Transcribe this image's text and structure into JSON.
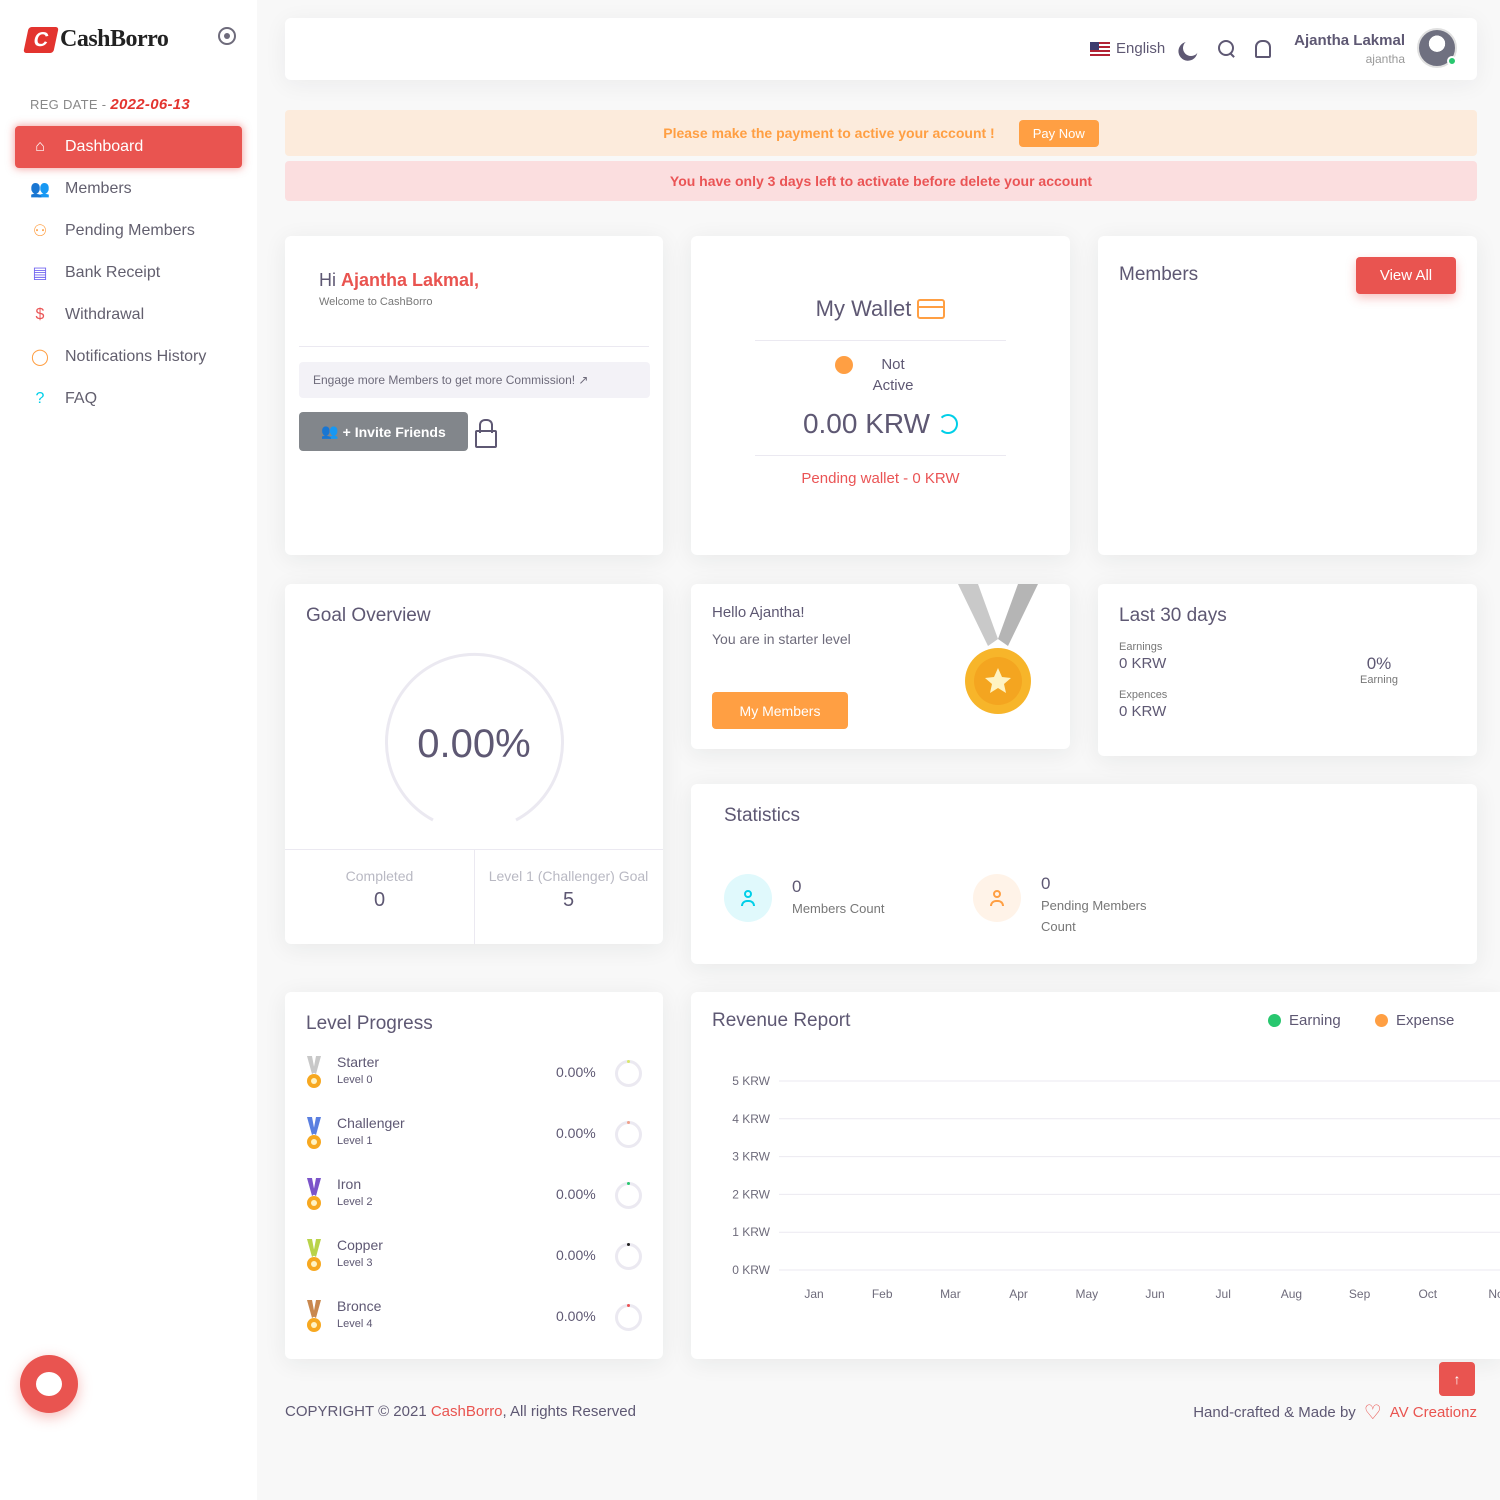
{
  "brand": {
    "name": "CashBorro",
    "accent": "#e95450"
  },
  "sidebar": {
    "reg_label": "REG DATE - ",
    "reg_date": "2022-06-13",
    "items": [
      {
        "label": "Dashboard",
        "icon": "home-icon",
        "active": true
      },
      {
        "label": "Members",
        "icon": "users-icon"
      },
      {
        "label": "Pending Members",
        "icon": "user-x-icon"
      },
      {
        "label": "Bank Receipt",
        "icon": "file-text-icon"
      },
      {
        "label": "Withdrawal",
        "icon": "dollar-icon"
      },
      {
        "label": "Notifications History",
        "icon": "message-circle-icon"
      },
      {
        "label": "FAQ",
        "icon": "help-circle-icon"
      }
    ]
  },
  "topbar": {
    "language": "English",
    "user_name": "Ajantha Lakmal",
    "username": "ajantha"
  },
  "alerts": {
    "payment_msg": "Please make the payment to active your account !",
    "pay_now": "Pay Now",
    "delete_msg": "You have only 3 days left to activate before delete your account"
  },
  "welcome": {
    "hi": "Hi",
    "name": "Ajantha Lakmal,",
    "sub": "Welcome to CashBorro",
    "engage": "Engage more Members to get more Commission! ↗",
    "invite": "+ Invite Friends"
  },
  "wallet": {
    "title": "My Wallet",
    "status": "Not Active",
    "amount": "0.00 KRW",
    "pending": "Pending wallet - 0 KRW"
  },
  "members_card": {
    "title": "Members",
    "view_all": "View All"
  },
  "goal": {
    "title": "Goal Overview",
    "percent": "0.00%",
    "completed_label": "Completed",
    "completed_value": "0",
    "goal_label": "Level 1 (Challenger) Goal",
    "goal_value": "5"
  },
  "hello": {
    "line1": "Hello Ajantha!",
    "line2": "You are in starter level",
    "button": "My Members"
  },
  "last30": {
    "title": "Last 30 days",
    "earnings_label": "Earnings",
    "earnings_value": "0 KRW",
    "expences_label": "Expences",
    "expences_value": "0 KRW",
    "pct": "0%",
    "pct_label": "Earning"
  },
  "statistics": {
    "title": "Statistics",
    "members_count": "0",
    "members_label": "Members Count",
    "pending_count": "0",
    "pending_label": "Pending Members Count"
  },
  "levels": {
    "title": "Level Progress",
    "items": [
      {
        "name": "Starter",
        "sub": "Level 0",
        "pct": "0.00%",
        "ribbon": "#c8c8c8",
        "dot": "#d9e86a"
      },
      {
        "name": "Challenger",
        "sub": "Level 1",
        "pct": "0.00%",
        "ribbon": "#5a7fe0",
        "dot": "#f0a08a"
      },
      {
        "name": "Iron",
        "sub": "Level 2",
        "pct": "0.00%",
        "ribbon": "#7b54c9",
        "dot": "#28c76f"
      },
      {
        "name": "Copper",
        "sub": "Level 3",
        "pct": "0.00%",
        "ribbon": "#b9d34a",
        "dot": "#222222"
      },
      {
        "name": "Bronce",
        "sub": "Level 4",
        "pct": "0.00%",
        "ribbon": "#c9884f",
        "dot": "#ea5455"
      }
    ]
  },
  "revenue": {
    "title": "Revenue Report",
    "legend_earning": "Earning",
    "legend_expense": "Expense",
    "earning_color": "#28c76f",
    "expense_color": "#ff9f43"
  },
  "chart_data": {
    "type": "line",
    "title": "Revenue Report",
    "x": [
      "Jan",
      "Feb",
      "Mar",
      "Apr",
      "May",
      "Jun",
      "Jul",
      "Aug",
      "Sep",
      "Oct",
      "No"
    ],
    "y_ticks": [
      "5 KRW",
      "4 KRW",
      "3 KRW",
      "2 KRW",
      "1 KRW",
      "0 KRW"
    ],
    "ylim": [
      0,
      5
    ],
    "series": [
      {
        "name": "Earning",
        "values": []
      },
      {
        "name": "Expense",
        "values": []
      }
    ]
  },
  "footer": {
    "copyright": "COPYRIGHT © 2021 ",
    "brand": "CashBorro",
    "rights": ", All rights Reserved",
    "made_by": "Hand-crafted & Made by",
    "maker": "AV Creationz"
  }
}
